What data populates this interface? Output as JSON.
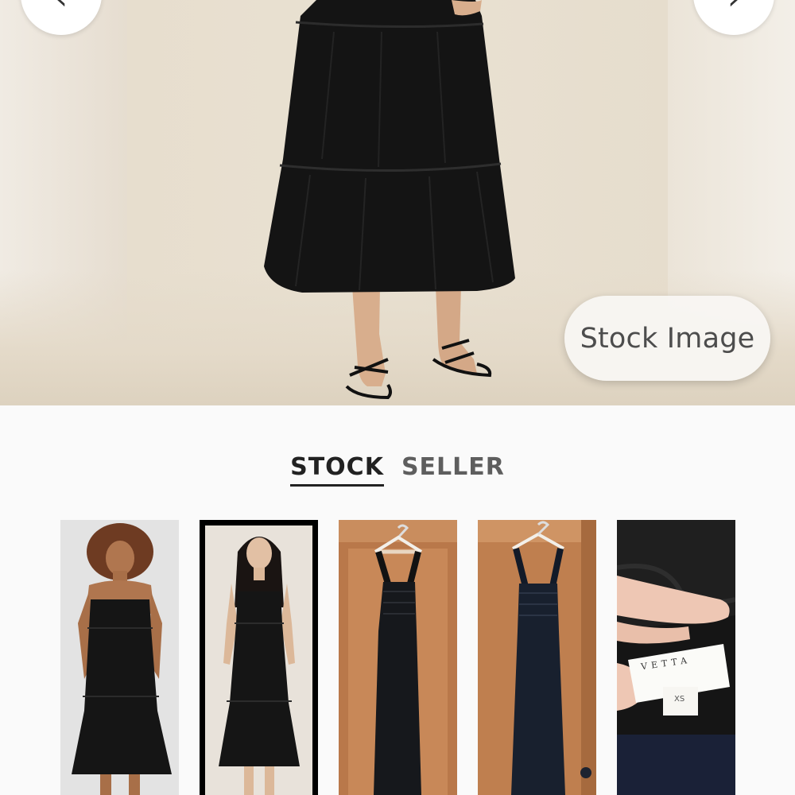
{
  "carousel": {
    "prev_icon": "chevron-left-icon",
    "next_icon": "chevron-right-icon",
    "prev_glyph": "‹",
    "next_glyph": "›",
    "badge_label": "Stock Image"
  },
  "tabs": [
    {
      "label": "STOCK",
      "active": true
    },
    {
      "label": "SELLER",
      "active": false
    }
  ],
  "thumbnails": [
    {
      "name": "model-curly-hair",
      "selected": false
    },
    {
      "name": "model-long-hair",
      "selected": true
    },
    {
      "name": "dress-on-hanger-1",
      "selected": false
    },
    {
      "name": "dress-on-hanger-2",
      "selected": false
    },
    {
      "name": "label-closeup",
      "selected": false,
      "label_text": "VETTA",
      "size_text": "XS"
    }
  ],
  "colors": {
    "dress": "#141414",
    "selected_border": "#000000",
    "wood_door": "#b9784a"
  }
}
